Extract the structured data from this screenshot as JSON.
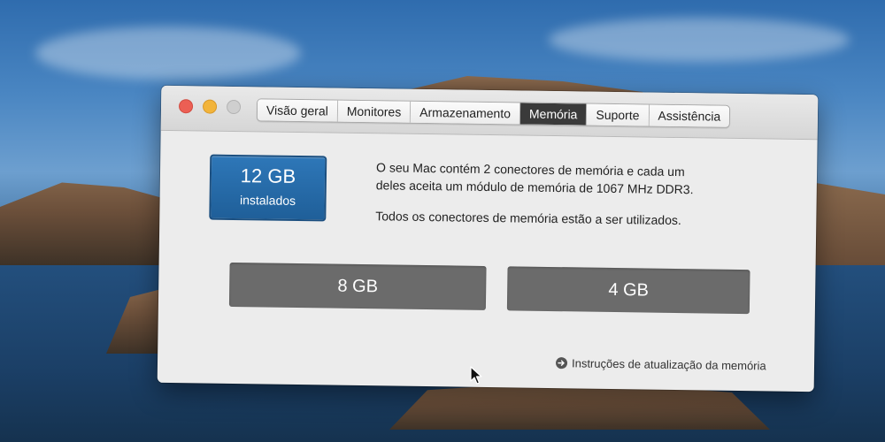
{
  "tabs": [
    "Visão geral",
    "Monitores",
    "Armazenamento",
    "Memória",
    "Suporte",
    "Assistência"
  ],
  "summary": {
    "amount": "12 GB",
    "label": "instalados"
  },
  "description": {
    "line1": "O seu Mac contém 2 conectores de memória e cada um",
    "line2": "deles aceita um módulo de memória de 1067 MHz DDR3.",
    "status": "Todos os conectores de memória estão a ser utilizados."
  },
  "slots": [
    "8 GB",
    "4 GB"
  ],
  "upgrade_link": "Instruções de atualização da memória",
  "colors": {
    "accent": "#2e77b8",
    "slot": "#6b6b6b",
    "active_tab": "#3a3a3a"
  }
}
